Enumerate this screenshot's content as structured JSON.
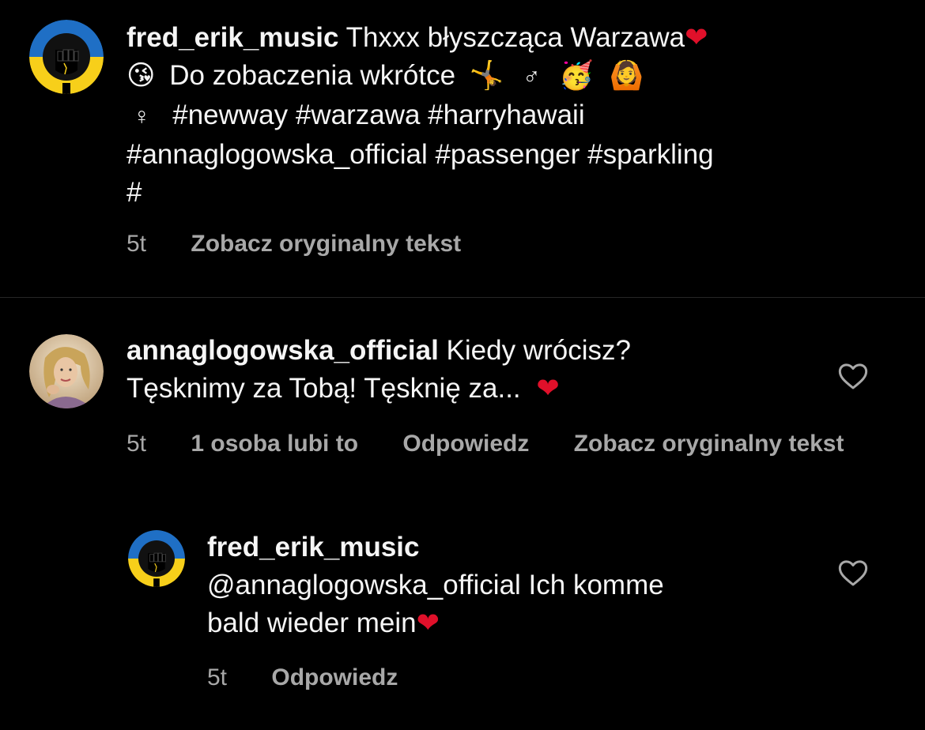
{
  "comments": [
    {
      "username": "fred_erik_music",
      "text_line1": "Thxxx błyszcząca Warzawa",
      "emoji_kiss": "😘",
      "text_line2": "Do zobaczenia wkrótce",
      "emoji_gymnast": "🤸",
      "male_sign": "♂",
      "emoji_party": "🥳",
      "emoji_person": "🙆",
      "female_sign": "♀",
      "hashtags_line1": "#newway #warzawa #harryhawaii",
      "hashtags_line2": "#annaglogowska_official #passenger #sparkling",
      "hashtags_line3": "#",
      "heart_emoji": "❤",
      "time": "5t",
      "see_original": "Zobacz oryginalny tekst"
    },
    {
      "username": "annaglogowska_official",
      "text_line1": "Kiedy wrócisz?",
      "text_line2": "Tęsknimy za Tobą! Tęsknię za...",
      "heart_emoji": "❤",
      "time": "5t",
      "likes": "1 osoba lubi to",
      "reply": "Odpowiedz",
      "see_original": "Zobacz oryginalny tekst"
    }
  ],
  "reply": {
    "username": "fred_erik_music",
    "mention": "@annaglogowska_official",
    "text_line1": "Ich komme",
    "text_line2": "bald wieder mein",
    "heart_emoji": "❤",
    "time": "5t",
    "reply_label": "Odpowiedz"
  },
  "icons": {
    "like": "heart-outline-icon",
    "avatar_fred": "ukraine-fist-avatar",
    "avatar_anna": "profile-photo-avatar"
  },
  "colors": {
    "background": "#000000",
    "text": "#f5f5f5",
    "secondary": "#a8a8a8",
    "heart": "#e0102a",
    "ukraine_blue": "#1f6fc5",
    "ukraine_yellow": "#f7cf1a"
  }
}
